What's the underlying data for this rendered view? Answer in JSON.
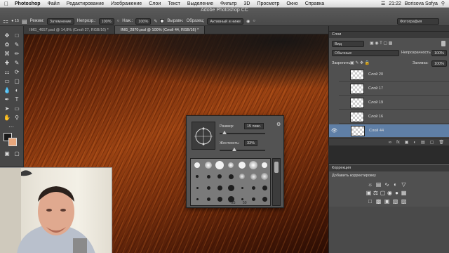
{
  "menubar": {
    "app": "Photoshop",
    "items": [
      "Файл",
      "Редактирование",
      "Изображение",
      "Слои",
      "Текст",
      "Выделение",
      "Фильтр",
      "3D",
      "Просмотр",
      "Окно",
      "Справка"
    ],
    "time": "21:22",
    "user": "Borisova Sofya"
  },
  "window_title": "Adobe Photoshop CC",
  "options": {
    "mode_label": "Режим:",
    "mode_value": "Затемнение",
    "opacity_label": "Непрозр.:",
    "opacity_value": "100%",
    "flow_label": "Наж.:",
    "flow_value": "100%",
    "align_label": "Выравн.",
    "sample_label": "Образец:",
    "sample_value": "Активный и ниже",
    "workspace": "Фотография"
  },
  "tabs": [
    {
      "label": "IMG_4657.psd @ 14,8% (Слой 27, RGB/16) *",
      "active": false
    },
    {
      "label": "IMG_2870.psd @ 100% (Слой 44, RGB/16) *",
      "active": true
    }
  ],
  "brush_popup": {
    "size_label": "Размер:",
    "size_value": "15 пикс.",
    "size_fraction": 0.1,
    "hardness_label": "Жесткость:",
    "hardness_value": "33%",
    "hardness_fraction": 0.33,
    "grid_numbers": [
      "25",
      "50"
    ]
  },
  "layers_panel": {
    "title": "Слои",
    "filter": "Вид",
    "blend_mode": "Обычные",
    "opacity_label": "Непрозрачность:",
    "opacity_value": "100%",
    "lock_label": "Закрепить:",
    "fill_label": "Заливка:",
    "fill_value": "100%",
    "layers": [
      {
        "name": "Слой 20",
        "selected": false,
        "visible": false
      },
      {
        "name": "Слой 17",
        "selected": false,
        "visible": false
      },
      {
        "name": "Слой 19",
        "selected": false,
        "visible": false
      },
      {
        "name": "Слой 16",
        "selected": false,
        "visible": false
      },
      {
        "name": "Слой 44",
        "selected": true,
        "visible": true
      }
    ]
  },
  "correction_panel": {
    "title": "Коррекция",
    "subtitle": "Добавить корректировку"
  },
  "colors": {
    "foreground": "#1a1a1a",
    "background": "#e8a77c",
    "selection": "#5f7fa6"
  }
}
